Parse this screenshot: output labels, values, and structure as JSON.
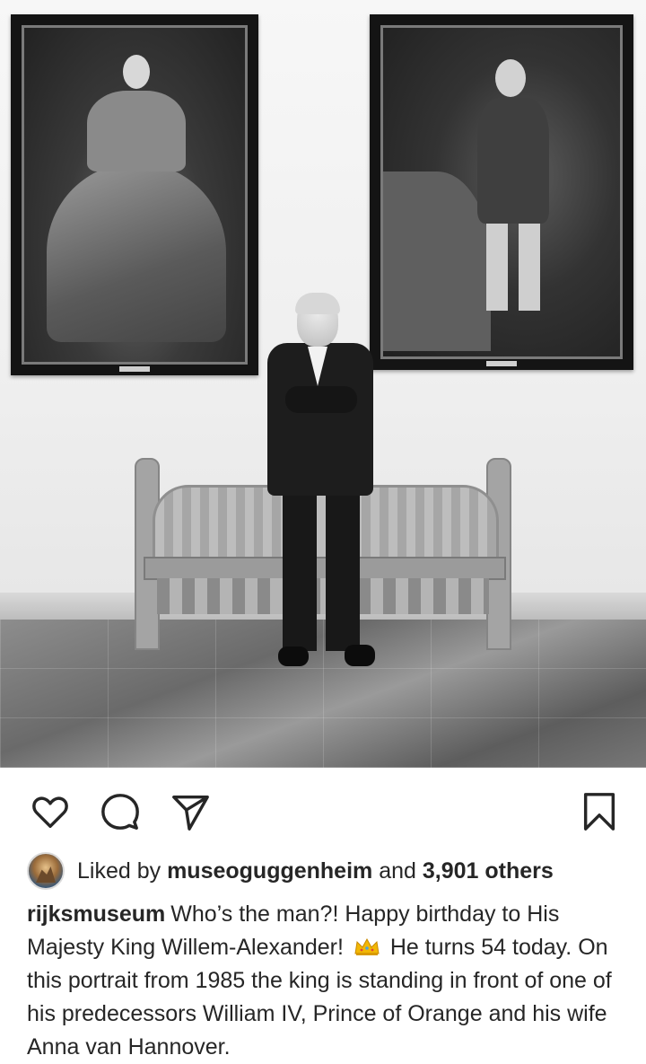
{
  "post": {
    "image_description_alt": "",
    "actions": {
      "like_icon": "heart-outline-icon",
      "comment_icon": "comment-bubble-icon",
      "share_icon": "paper-plane-icon",
      "save_icon": "bookmark-icon"
    },
    "likes": {
      "prefix": "Liked by",
      "user": "museoguggenheim",
      "and": "and",
      "count_text": "3,901 others"
    },
    "caption": {
      "username": "rijksmuseum",
      "text_before_emoji": "Who’s the man?! Happy birthday to His Majesty King Willem-Alexander!",
      "emoji": "👑",
      "text_after_emoji": "He turns 54 today. On this portrait from 1985 the king is standing in front of one of his predecessors William IV, Prince of Orange and his wife Anna van Hannover."
    }
  },
  "colors": {
    "text": "#262626",
    "icon": "#262626",
    "background": "#ffffff"
  }
}
